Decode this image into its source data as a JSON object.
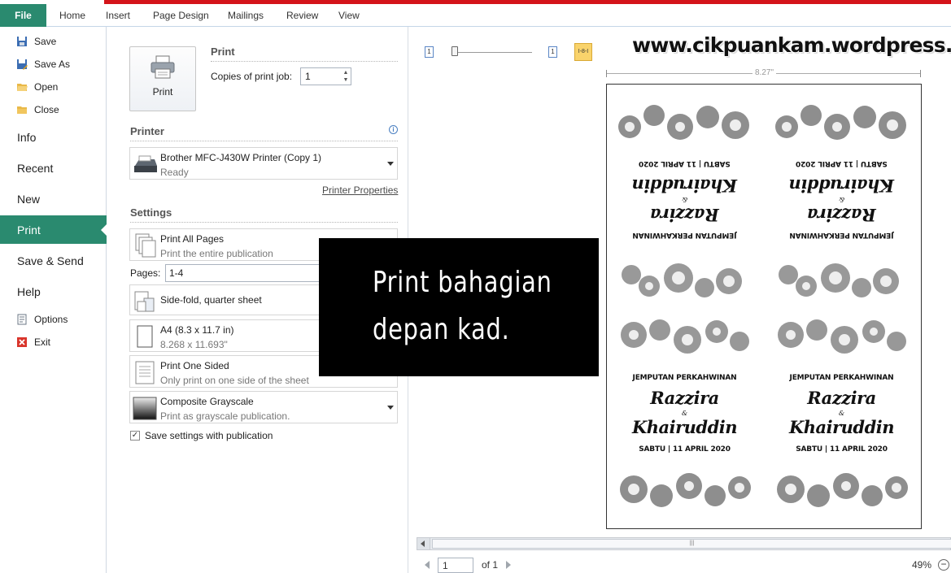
{
  "ribbon": {
    "file_tab": "File",
    "tabs": [
      "Home",
      "Insert",
      "Page Design",
      "Mailings",
      "Review",
      "View"
    ]
  },
  "nav": {
    "save": "Save",
    "save_as": "Save As",
    "open": "Open",
    "close": "Close",
    "info": "Info",
    "recent": "Recent",
    "new": "New",
    "print": "Print",
    "save_send": "Save & Send",
    "help": "Help",
    "options": "Options",
    "exit": "Exit"
  },
  "print_panel": {
    "print_button": "Print",
    "print_heading": "Print",
    "copies_label": "Copies of print job:",
    "copies_value": "1",
    "printer_heading": "Printer",
    "printer_name": "Brother MFC-J430W Printer (Copy 1)",
    "printer_status": "Ready",
    "printer_properties": "Printer Properties",
    "settings_heading": "Settings",
    "pages_scope": "Print All Pages",
    "pages_scope_desc": "Print the entire publication",
    "pages_label": "Pages:",
    "pages_value": "1-4",
    "layout": "Side-fold, quarter sheet",
    "paper": "A4 (8.3 x 11.7 in)",
    "paper_desc": "8.268 x 11.693\"",
    "sides": "Print One Sided",
    "sides_desc": "Only print on one side of the sheet",
    "color": "Composite Grayscale",
    "color_desc": "Print as grayscale publication.",
    "save_settings": "Save settings with publication"
  },
  "preview": {
    "watermark": "www.cikpuankam.wordpress.com",
    "ruler_width": "8.27\"",
    "page_icon_num": "1",
    "card": {
      "title": "JEMPUTAN PERKAHWINAN",
      "name1": "Razzira",
      "amp": "&",
      "name2": "Khairuddin",
      "date": "SABTU |  11 APRIL 2020"
    },
    "callout_line1": "Print  bahagian",
    "callout_line2": "depan  kad.",
    "page_current": "1",
    "page_of": "of 1",
    "zoom": "49%"
  },
  "colors": {
    "accent": "#2a8a6f",
    "top_line": "#d4141a"
  }
}
